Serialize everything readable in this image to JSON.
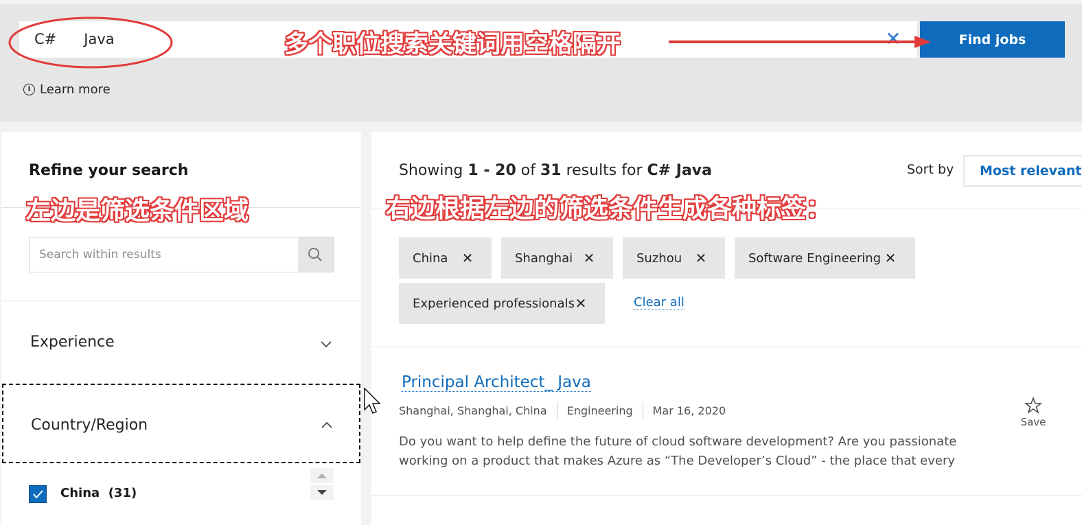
{
  "search": {
    "value": "C#      Java",
    "find_label": "Find jobs",
    "learn_more": "Learn more"
  },
  "annotations": {
    "top": "多个职位搜索关键词用空格隔开",
    "left": "左边是筛选条件区域",
    "right": "右边根据左边的筛选条件生成各种标签："
  },
  "refine": {
    "title": "Refine your search",
    "within_placeholder": "Search within results",
    "facets": [
      {
        "label": "Experience",
        "expanded": false
      },
      {
        "label": "Country/Region",
        "expanded": true
      }
    ],
    "country_options": [
      {
        "label": "China  (31)",
        "checked": true
      }
    ]
  },
  "results": {
    "showing_prefix": "Showing ",
    "range": "1 - 20",
    "of_text": " of ",
    "total": "31",
    "results_for": " results for ",
    "query": "C# Java",
    "sort_label": "Sort by",
    "sort_value": "Most relevant"
  },
  "chips": [
    "China",
    "Shanghai",
    "Suzhou",
    "Software Engineering",
    "Experienced professionals"
  ],
  "clear_all": "Clear all",
  "job": {
    "title": "Principal Architect_ Java",
    "location": "Shanghai, Shanghai, China",
    "category": "Engineering",
    "date": "Mar 16, 2020",
    "description": "Do you want to help define the future of cloud software development? Are you passionate working on a product that makes Azure as “The Developer’s Cloud” - the place that every",
    "save_label": "Save"
  },
  "colors": {
    "accent": "#0f6cbd",
    "annotation": "#e23b3b",
    "topbar": "#e6e6e6",
    "chip": "#e6e6e6"
  }
}
